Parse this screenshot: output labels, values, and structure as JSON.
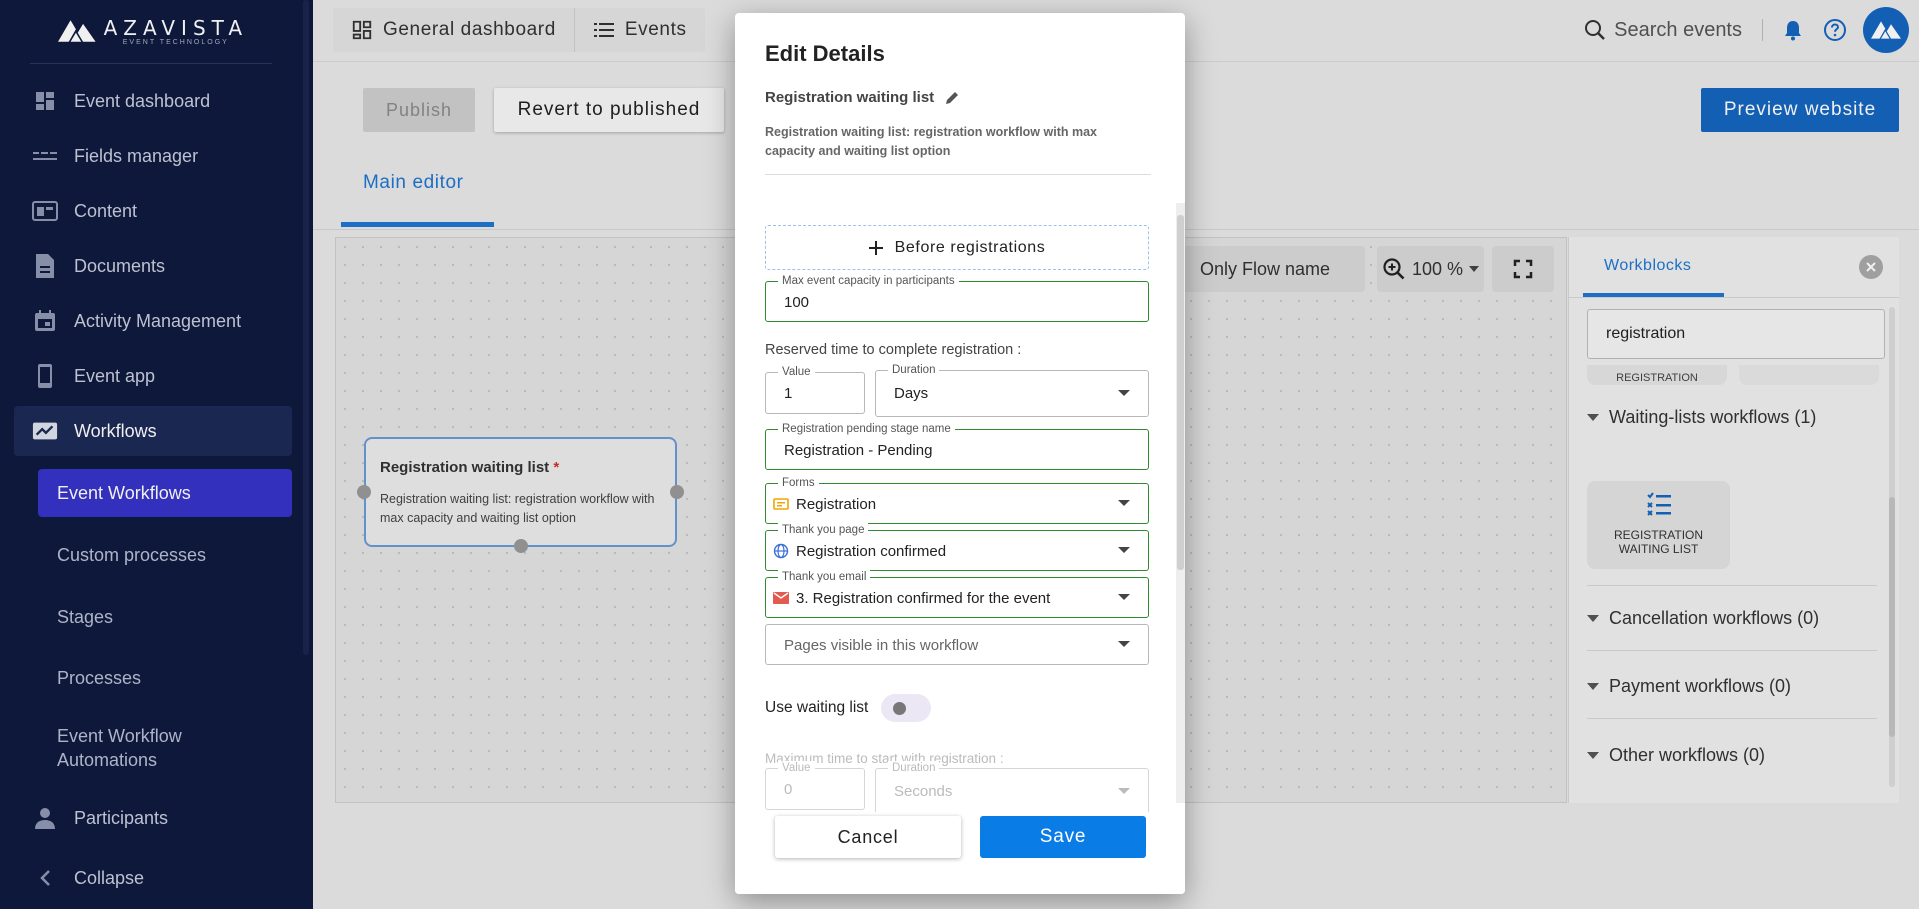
{
  "brand": {
    "name": "AZAVISTA",
    "tagline": "EVENT TECHNOLOGY"
  },
  "sidebar": {
    "items": [
      {
        "label": "Event dashboard",
        "icon": "dashboard-icon"
      },
      {
        "label": "Fields manager",
        "icon": "fields-icon"
      },
      {
        "label": "Content",
        "icon": "content-icon"
      },
      {
        "label": "Documents",
        "icon": "document-icon"
      },
      {
        "label": "Activity Management",
        "icon": "calendar-icon"
      },
      {
        "label": "Event app",
        "icon": "phone-icon"
      },
      {
        "label": "Workflows",
        "icon": "workflow-icon",
        "active": true
      }
    ],
    "sub_items": [
      {
        "label": "Event Workflows",
        "active": true
      },
      {
        "label": "Custom processes"
      },
      {
        "label": "Stages"
      },
      {
        "label": "Processes"
      },
      {
        "label": "Event Workflow Automations"
      }
    ],
    "participants": "Participants",
    "collapse": "Collapse"
  },
  "topbar": {
    "tabs": [
      "General dashboard",
      "Events"
    ],
    "search_placeholder": "Search events"
  },
  "main": {
    "publish": "Publish",
    "revert": "Revert to published",
    "preview": "Preview website",
    "tab": "Main editor",
    "only_flow_name": "Only Flow name",
    "zoom": "100 %"
  },
  "node": {
    "title": "Registration waiting list",
    "required_mark": "*",
    "description": "Registration waiting list: registration workflow with max capacity and waiting list option"
  },
  "workblocks": {
    "tab": "Workblocks",
    "search_value": "registration",
    "partial_card": "REGISTRATION",
    "sections": [
      "Waiting-lists workflows (1)",
      "Cancellation workflows (0)",
      "Payment workflows (0)",
      "Other workflows (0)"
    ],
    "card_label": "REGISTRATION WAITING LIST"
  },
  "modal": {
    "title": "Edit Details",
    "workflow_name": "Registration waiting list",
    "workflow_desc": "Registration waiting list: registration workflow with max capacity and waiting list option",
    "before_registrations": "Before registrations",
    "capacity": {
      "label": "Max event capacity in participants",
      "value": "100"
    },
    "reserved_time_label": "Reserved time to complete registration :",
    "reserved_value": {
      "label": "Value",
      "value": "1"
    },
    "reserved_duration": {
      "label": "Duration",
      "value": "Days"
    },
    "pending_stage": {
      "label": "Registration pending stage name",
      "value": "Registration - Pending"
    },
    "forms": {
      "label": "Forms",
      "value": "Registration"
    },
    "thank_you_page": {
      "label": "Thank you page",
      "value": "Registration confirmed"
    },
    "thank_you_email": {
      "label": "Thank you email",
      "value": "3. Registration confirmed for the event"
    },
    "pages_visible_placeholder": "Pages visible in this workflow",
    "use_waiting_list": "Use waiting list",
    "max_time_label": "Maximum time to start with registration :",
    "max_value": {
      "label": "Value",
      "value": "0"
    },
    "max_duration": {
      "label": "Duration",
      "value": "Seconds"
    },
    "cancel": "Cancel",
    "save": "Save"
  },
  "colors": {
    "sidebar_bg": "#0e1a3f",
    "active_sub": "#3634c8",
    "accent": "#1565c0",
    "save_button": "#0a7ce6",
    "valid_border": "#2e8b2e"
  }
}
